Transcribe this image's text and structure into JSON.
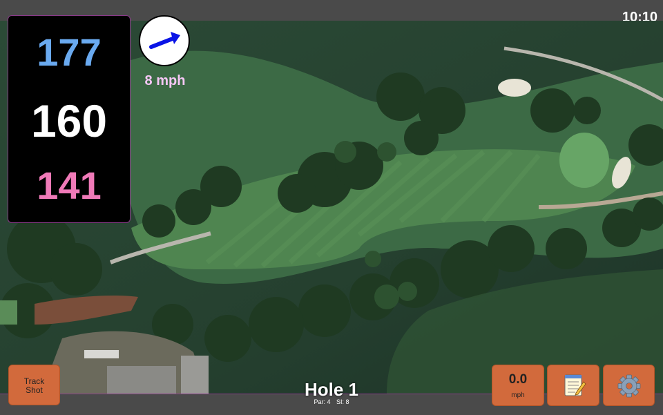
{
  "status_bar": {
    "time": "10:10"
  },
  "distances": {
    "back": "177",
    "middle": "160",
    "front": "141"
  },
  "wind": {
    "speed": "8 mph",
    "icon": "wind-arrow-icon",
    "color": "#0a14e6"
  },
  "hole": {
    "title": "Hole 1",
    "par": "Par: 4",
    "stroke_index": "SI: 8"
  },
  "buttons": {
    "track_shot": {
      "line1": "Track",
      "line2": "Shot"
    },
    "speed": {
      "value": "0.0",
      "unit": "mph"
    },
    "notes": {
      "icon": "notepad-icon"
    },
    "settings": {
      "icon": "gear-icon"
    }
  },
  "colors": {
    "button": "#d26a3c",
    "back_distance": "#6aaaf0",
    "middle_distance": "#ffffff",
    "front_distance": "#f07ab8",
    "accent_border": "#8a3a8a"
  }
}
